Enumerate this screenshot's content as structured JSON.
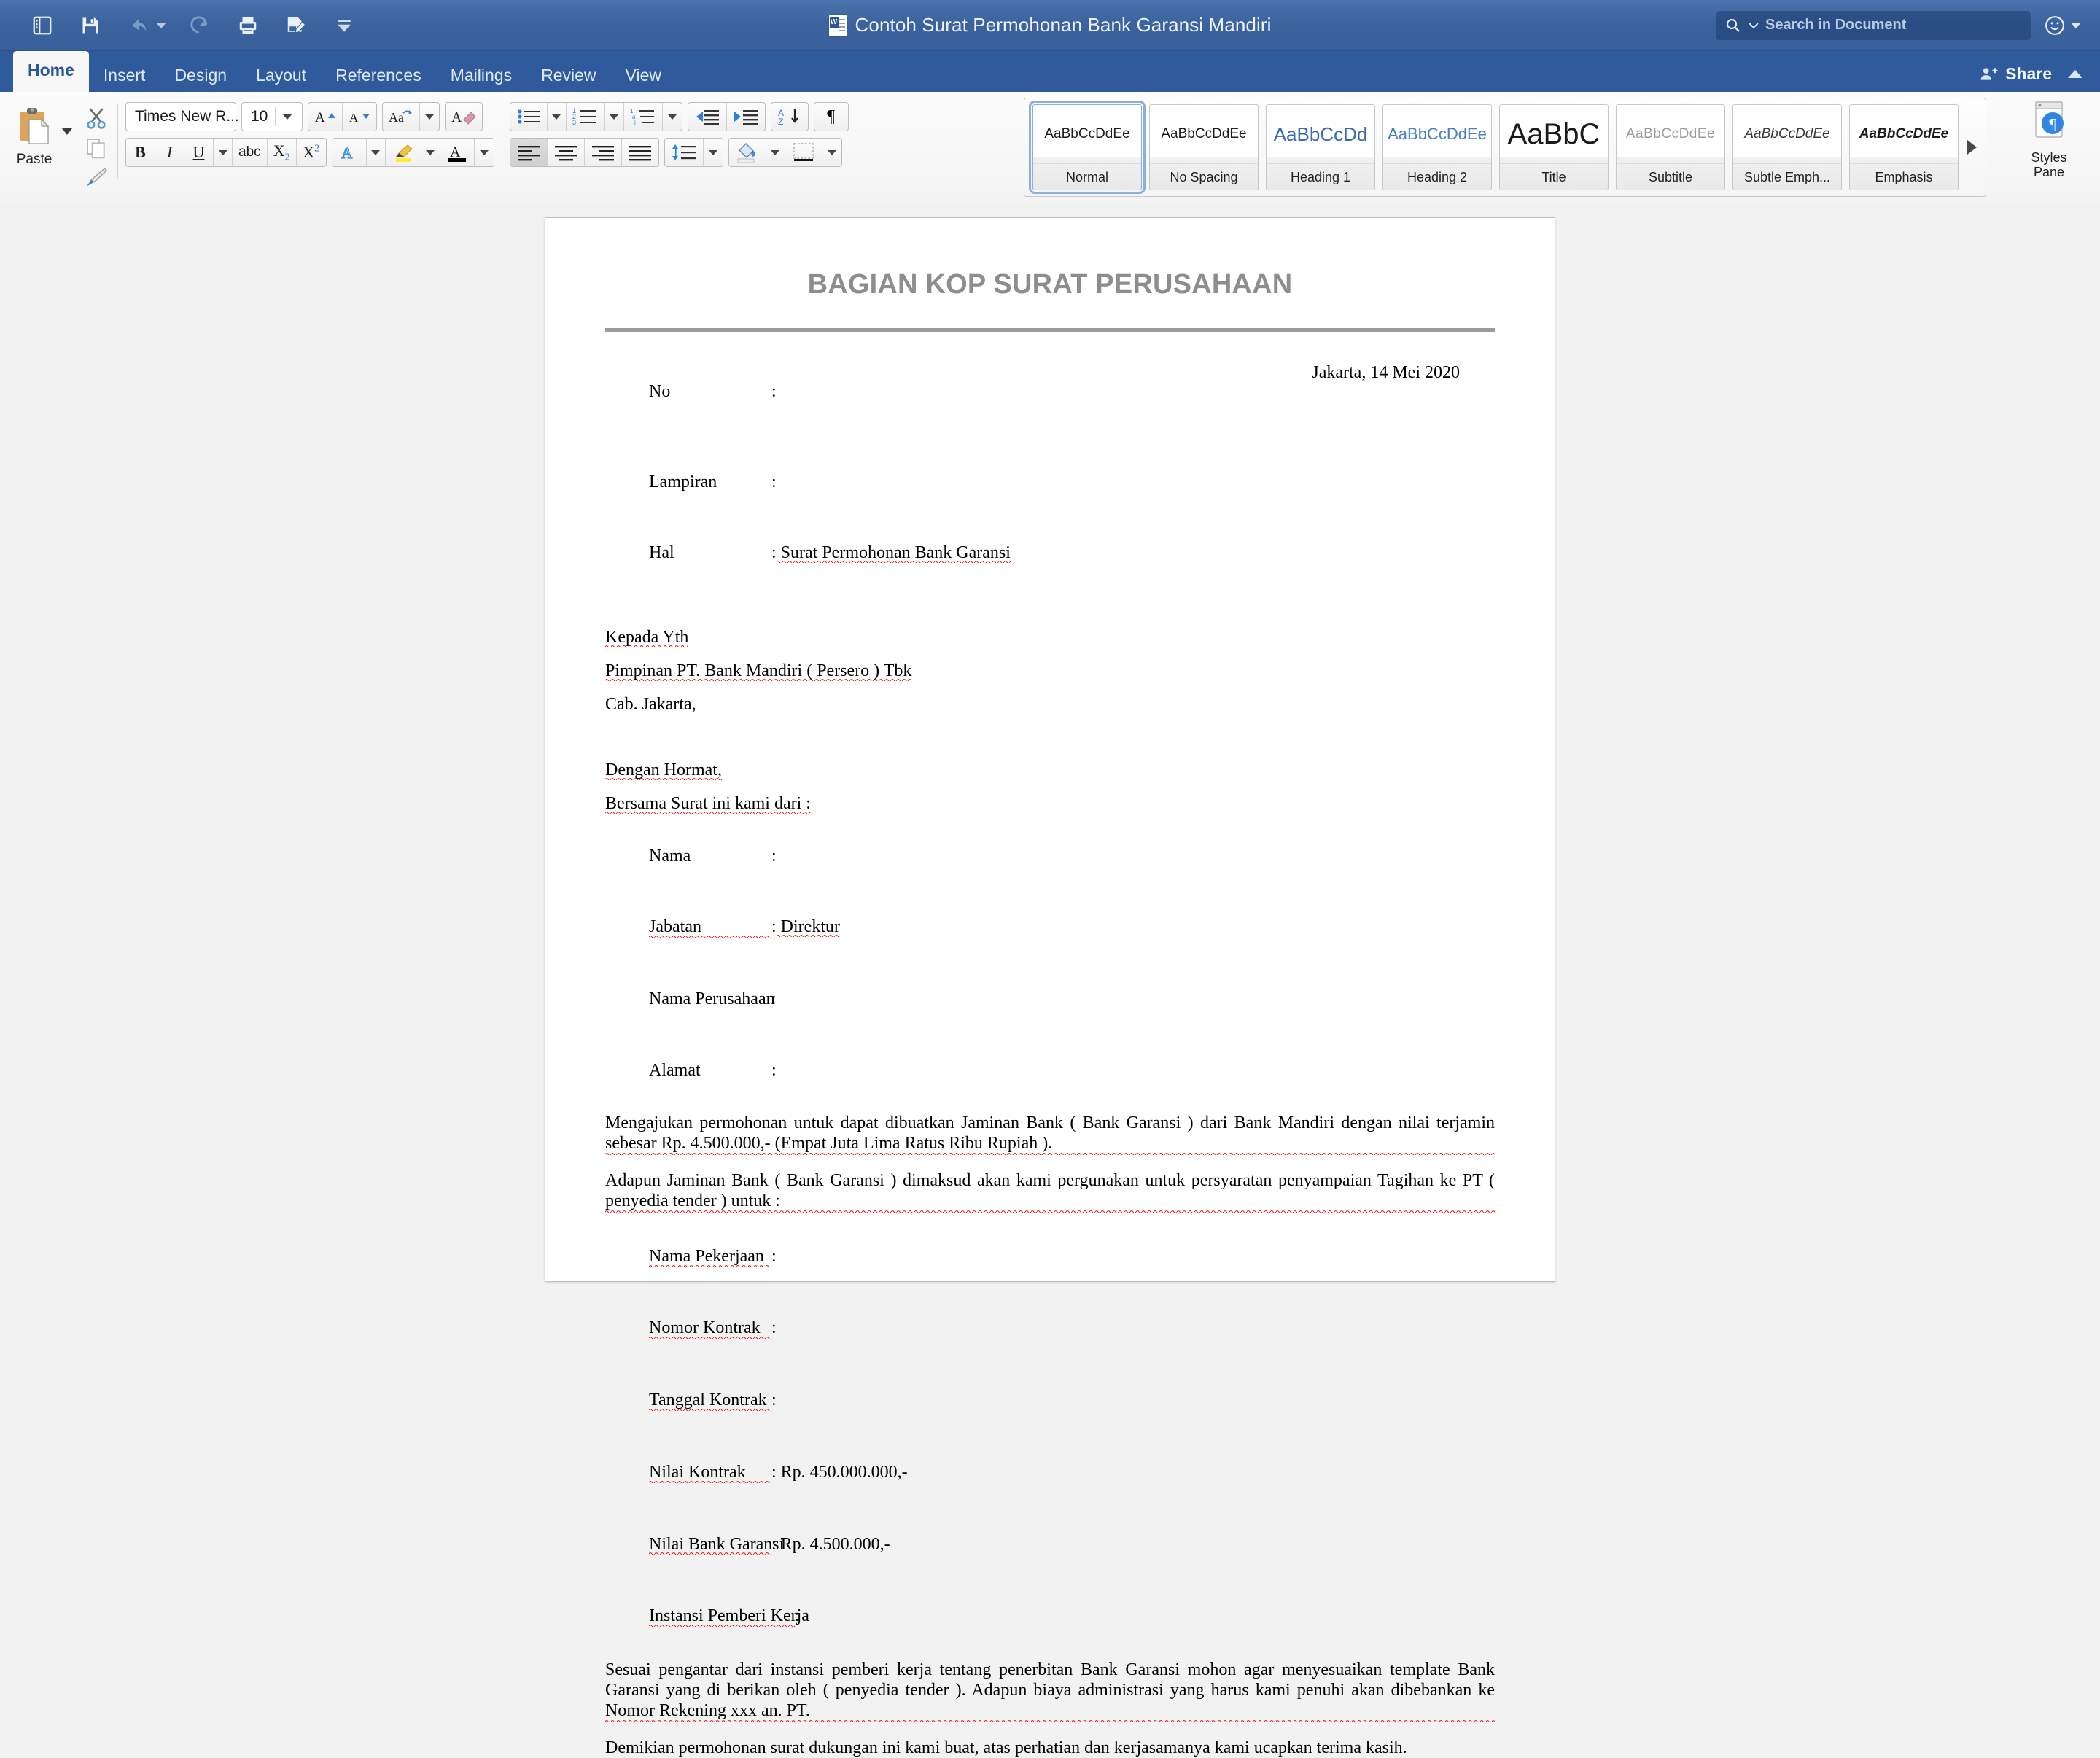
{
  "titlebar": {
    "document_title": "Contoh Surat Permohonan Bank Garansi Mandiri",
    "search_placeholder": "Search in Document",
    "quick_access": [
      {
        "name": "sidebar-toggle-icon",
        "label": "Sidebar"
      },
      {
        "name": "save-icon",
        "label": "Save"
      },
      {
        "name": "undo-icon",
        "label": "Undo"
      },
      {
        "name": "redo-icon",
        "label": "Redo"
      },
      {
        "name": "print-icon",
        "label": "Print"
      },
      {
        "name": "track-changes-icon",
        "label": "Track Changes"
      },
      {
        "name": "customize-toolbar-icon",
        "label": "Customize"
      }
    ]
  },
  "ribbon": {
    "tabs": [
      {
        "label": "Home",
        "active": true
      },
      {
        "label": "Insert",
        "active": false
      },
      {
        "label": "Design",
        "active": false
      },
      {
        "label": "Layout",
        "active": false
      },
      {
        "label": "References",
        "active": false
      },
      {
        "label": "Mailings",
        "active": false
      },
      {
        "label": "Review",
        "active": false
      },
      {
        "label": "View",
        "active": false
      }
    ],
    "share_label": "Share",
    "clipboard": {
      "paste_label": "Paste"
    },
    "font": {
      "family_value": "Times New R...",
      "size_value": "10"
    },
    "styles_pane_label_line1": "Styles",
    "styles_pane_label_line2": "Pane",
    "styles": [
      {
        "preview": "AaBbCcDdEe",
        "name": "Normal",
        "selected": true,
        "class": "sp-normal"
      },
      {
        "preview": "AaBbCcDdEe",
        "name": "No Spacing",
        "selected": false,
        "class": "sp-nospace"
      },
      {
        "preview": "AaBbCcDd",
        "name": "Heading 1",
        "selected": false,
        "class": "sp-h1"
      },
      {
        "preview": "AaBbCcDdEe",
        "name": "Heading 2",
        "selected": false,
        "class": "sp-h2"
      },
      {
        "preview": "AaBbC",
        "name": "Title",
        "selected": false,
        "class": "sp-title"
      },
      {
        "preview": "AaBbCcDdEe",
        "name": "Subtitle",
        "selected": false,
        "class": "sp-subtitle"
      },
      {
        "preview": "AaBbCcDdEe",
        "name": "Subtle Emph...",
        "selected": false,
        "class": "sp-subemph"
      },
      {
        "preview": "AaBbCcDdEe",
        "name": "Emphasis",
        "selected": false,
        "class": "sp-emph"
      }
    ]
  },
  "document": {
    "letterhead": "BAGIAN KOP SURAT PERUSAHAAN",
    "date": "Jakarta, 14 Mei 2020",
    "fields_top": [
      {
        "label": "No",
        "colon": ":",
        "value": ""
      },
      {
        "label": "Lampiran",
        "colon": ":",
        "value": ""
      },
      {
        "label": "Hal",
        "colon": ":",
        "value": " Surat Permohonan Bank Garansi"
      }
    ],
    "addressee": [
      "Kepada Yth",
      "Pimpinan PT. Bank Mandiri ( Persero ) Tbk",
      "Cab. Jakarta,"
    ],
    "salutation": "Dengan Hormat,",
    "intro": "Bersama Surat ini kami dari :",
    "fields_applicant": [
      {
        "label": "Nama",
        "colon": ":",
        "value": ""
      },
      {
        "label": "Jabatan",
        "colon": ":",
        "value": " Direktur"
      },
      {
        "label": "Nama Perusahaan",
        "colon": ":",
        "value": ""
      },
      {
        "label": "Alamat",
        "colon": ":",
        "value": ""
      }
    ],
    "para1": "Mengajukan permohonan untuk dapat dibuatkan Jaminan Bank ( Bank Garansi ) dari Bank Mandiri dengan nilai terjamin sebesar Rp. 4.500.000,- (Empat Juta Lima Ratus Ribu Rupiah ).",
    "para2": "Adapun Jaminan Bank ( Bank Garansi ) dimaksud akan kami pergunakan untuk persyaratan penyampaian Tagihan ke PT ( penyedia tender ) untuk :",
    "fields_contract": [
      {
        "label": "Nama Pekerjaan",
        "colon": ":",
        "value": ""
      },
      {
        "label": "Nomor Kontrak",
        "colon": ":",
        "value": ""
      },
      {
        "label": "Tanggal Kontrak",
        "colon": ":",
        "value": ""
      },
      {
        "label": "Nilai Kontrak",
        "colon": ":",
        "value": " Rp. 450.000.000,-"
      },
      {
        "label": "Nilai Bank Garansi",
        "colon": ":",
        "value": " Rp. 4.500.000,-"
      },
      {
        "label": "Instansi Pemberi Kerja",
        "colon": ":",
        "value": ""
      }
    ],
    "para3": "Sesuai pengantar dari instansi pemberi kerja tentang penerbitan Bank Garansi mohon agar menyesuaikan template Bank Garansi yang di berikan oleh ( penyedia tender ). Adapun biaya administrasi yang harus kami penuhi akan dibebankan ke Nomor Rekening xxx an. PT.",
    "para4": "Demikian permohonan surat dukungan ini kami buat, atas perhatian dan kerjasamanya kami ucapkan terima kasih."
  },
  "colors": {
    "titlebar": "#3c639e",
    "tabstrip": "#2f5b9c",
    "active_tab_text": "#2b579a",
    "letterhead_gray": "#8d8d8d",
    "spellcheck_red": "#e02020"
  }
}
